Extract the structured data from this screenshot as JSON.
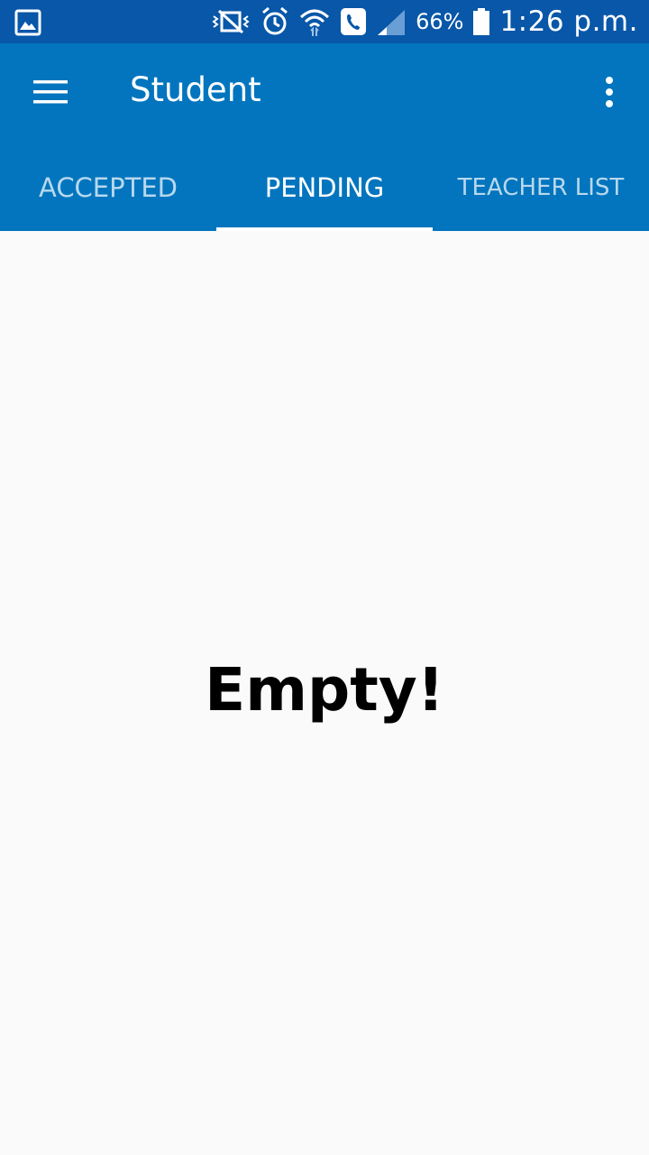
{
  "status_bar": {
    "battery_percent": "66%",
    "time": "1:26 p.m.",
    "icons": [
      "gallery-icon",
      "vibrate-icon",
      "alarm-icon",
      "wifi-icon",
      "call-icon",
      "signal-icon",
      "battery-icon"
    ]
  },
  "appbar": {
    "title": "Student"
  },
  "tabs": [
    {
      "label": "ACCEPTED",
      "active": false
    },
    {
      "label": "PENDING",
      "active": true
    },
    {
      "label": "TEACHER LIST",
      "active": false
    }
  ],
  "content": {
    "empty_message": "Empty!"
  },
  "colors": {
    "status_bar": "#0857a8",
    "primary": "#0275be",
    "background": "#fafafa"
  }
}
